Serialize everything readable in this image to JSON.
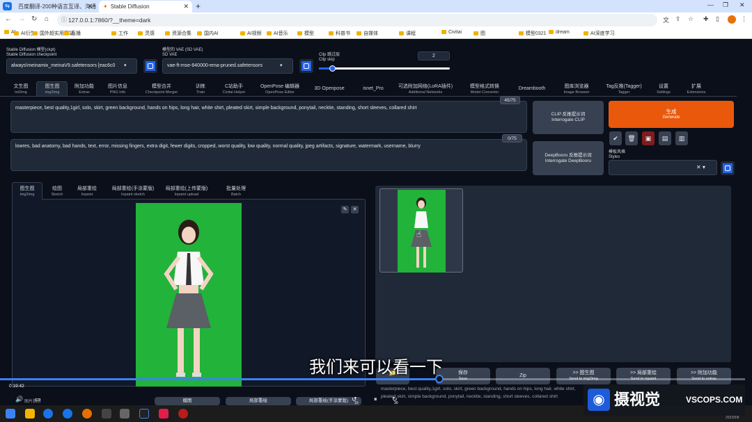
{
  "browser": {
    "tabs": [
      {
        "label": "百度翻译-200种语言互译、沟通"
      },
      {
        "label": "Stable Diffusion"
      }
    ],
    "new_tab": "+",
    "url": "127.0.0.1:7860/?__theme=dark",
    "bookmarks": [
      "AI",
      "AI衍生",
      "国外超实用网站",
      "直播",
      "工作",
      "灵感",
      "资源合集",
      "国内AI",
      "AI视频",
      "AI音乐",
      "模型",
      "科普书",
      "自媒体",
      "课程",
      "Civitai",
      "图",
      "模型0321",
      "dream",
      "AI深度学习"
    ]
  },
  "settings": {
    "ckpt_label": "Stable Diffusion 模型(ckpt)",
    "ckpt_label_en": "Stable Diffusion checkpoint",
    "ckpt_value": "always\\meinamix_meinaV9.safetensors [eac6c0",
    "vae_label": "模型的 VAE (SD VAE)",
    "vae_label_en": "SD VAE",
    "vae_value": "vae-ft-mse-840000-ema-pruned.safetensors",
    "clip_label": "Clip 跳过层",
    "clip_label_en": "Clip skip",
    "clip_value": "2",
    "clip_fraction": 0.1
  },
  "top_tabs": [
    {
      "cn": "文生图",
      "en": "txt2img"
    },
    {
      "cn": "图生图",
      "en": "img2img"
    },
    {
      "cn": "附加功能",
      "en": "Extras"
    },
    {
      "cn": "图片信息",
      "en": "PNG Info"
    },
    {
      "cn": "模型合并",
      "en": "Checkpoint Merger"
    },
    {
      "cn": "训练",
      "en": "Train"
    },
    {
      "cn": "C站助手",
      "en": "Civitai Helper"
    },
    {
      "cn": "OpenPose 编辑器",
      "en": "OpenPose Editor"
    },
    {
      "cn": "3D Openpose",
      "en": ""
    },
    {
      "cn": "isnet_Pro",
      "en": ""
    },
    {
      "cn": "可选附加网络(LoRA插件)",
      "en": "Additional Networks"
    },
    {
      "cn": "模型格式转换",
      "en": "Model Converter"
    },
    {
      "cn": "Dreambooth",
      "en": ""
    },
    {
      "cn": "图库浏览器",
      "en": "Image Browser"
    },
    {
      "cn": "Tag反推(Tagger)",
      "en": "Tagger"
    },
    {
      "cn": "设置",
      "en": "Settings"
    },
    {
      "cn": "扩展",
      "en": "Extensions"
    }
  ],
  "prompt": {
    "text": "masterpiece, best quality,1girl, solo, skirt, green background, hands on hips, long hair, white shirt, pleated skirt, simple background, ponytail, necktie, standing, short sleeves, collared shirt",
    "count": "45/75"
  },
  "negative": {
    "text": "lowres, bad anatomy, bad hands, text, error, missing fingers, extra digit, fewer digits, cropped, worst quality, low quality, normal quality, jpeg artifacts, signature, watermark, username, blurry",
    "count": "0/75"
  },
  "buttons": {
    "clip_cn": "CLIP 反推提示词",
    "clip_en": "Interrogate CLIP",
    "deepbooru_cn": "DeepBooru 反推提示词",
    "deepbooru_en": "Interrogate DeepBooru",
    "generate_cn": "生成",
    "generate_en": "Generate",
    "styles_cn": "模板风格",
    "styles_en": "Styles"
  },
  "tool_icons": [
    "✔",
    "🗑",
    "▣",
    "▤",
    "▥"
  ],
  "sub_tabs": [
    {
      "cn": "图生图",
      "en": "img2img"
    },
    {
      "cn": "绘图",
      "en": "Sketch"
    },
    {
      "cn": "局部重绘",
      "en": "Inpaint"
    },
    {
      "cn": "局部重绘(手涂蒙版)",
      "en": "Inpaint sketch"
    },
    {
      "cn": "局部重绘(上传蒙版)",
      "en": "Inpaint upload"
    },
    {
      "cn": "批量处理",
      "en": "Batch"
    }
  ],
  "output_buttons": [
    {
      "cn": "保存",
      "en": "Save"
    },
    {
      "cn": "Zip",
      "en": ""
    },
    {
      "cn": ">> 图生图",
      "en": "Send to img2img"
    },
    {
      "cn": ">> 局部重绘",
      "en": "Send to inpaint"
    },
    {
      "cn": ">> 附加功能",
      "en": "Send to extras"
    }
  ],
  "output_text": "masterpiece, best quality,1girl, solo, skirt, green background, hands on hips, long hair, white shirt, pleated skirt, simple background, ponytail, necktie, standing, short sleeves, collared shirt",
  "bottom_tabs": [
    "模图",
    "局部重绘",
    "局部重绘(手涂蒙版)"
  ],
  "video": {
    "time": "0:19:42",
    "subtitle": "我们来可以看一下",
    "skip_back": "10",
    "skip_fwd": "30",
    "progress": 0.59,
    "cursor_hint": "图片指示"
  },
  "watermark": {
    "brand": "摄视觉",
    "site": "VSCOPS.COM",
    "date": "2023/5/8"
  },
  "colors": {
    "bg": "#0b0f19",
    "panel": "#1f2937",
    "generate": "#ea580c",
    "blue": "#2563eb",
    "green": "#22b33a"
  }
}
